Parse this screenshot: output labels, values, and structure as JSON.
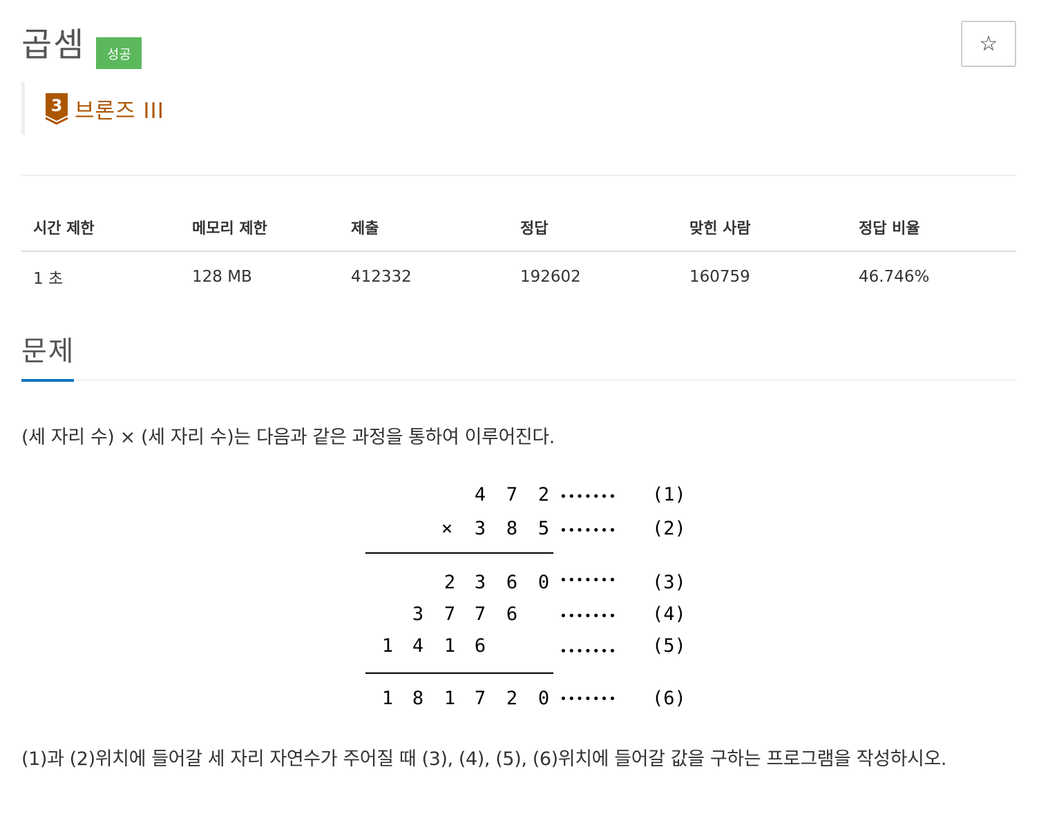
{
  "problem": {
    "title": "곱셈",
    "status_badge": "성공",
    "star_icon": "star-outline-icon",
    "star_glyph": "☆",
    "tier": {
      "number": "3",
      "label": "브론즈 III",
      "color": "#ad5600",
      "icon": "bronze-3-tier-icon"
    }
  },
  "info_table": {
    "headers": [
      "시간 제한",
      "메모리 제한",
      "제출",
      "정답",
      "맞힌 사람",
      "정답 비율"
    ],
    "values": [
      "1 초",
      "128 MB",
      "412332",
      "192602",
      "160759",
      "46.746%"
    ]
  },
  "section": {
    "title": "문제",
    "accent_color": "#0e76c2"
  },
  "description": {
    "intro": "(세 자리 수) × (세 자리 수)는 다음과 같은 과정을 통하여 이루어진다.",
    "outro": "(1)과 (2)위치에 들어갈 세 자리 자연수가 주어질 때 (3), (4), (5), (6)위치에 들어갈 값을 구하는 프로그램을 작성하시오."
  },
  "figure": {
    "times_sign": "×",
    "leader": "•••••••",
    "rows": [
      {
        "digits": [
          "4",
          "7",
          "2"
        ],
        "label": "(1)"
      },
      {
        "digits": [
          "3",
          "8",
          "5"
        ],
        "label": "(2)"
      },
      {
        "digits": [
          "2",
          "3",
          "6",
          "0"
        ],
        "label": "(3)"
      },
      {
        "digits": [
          "3",
          "7",
          "7",
          "6"
        ],
        "label": "(4)"
      },
      {
        "digits": [
          "1",
          "4",
          "1",
          "6"
        ],
        "label": "(5)"
      },
      {
        "digits": [
          "1",
          "8",
          "1",
          "7",
          "2",
          "0"
        ],
        "label": "(6)"
      }
    ]
  }
}
